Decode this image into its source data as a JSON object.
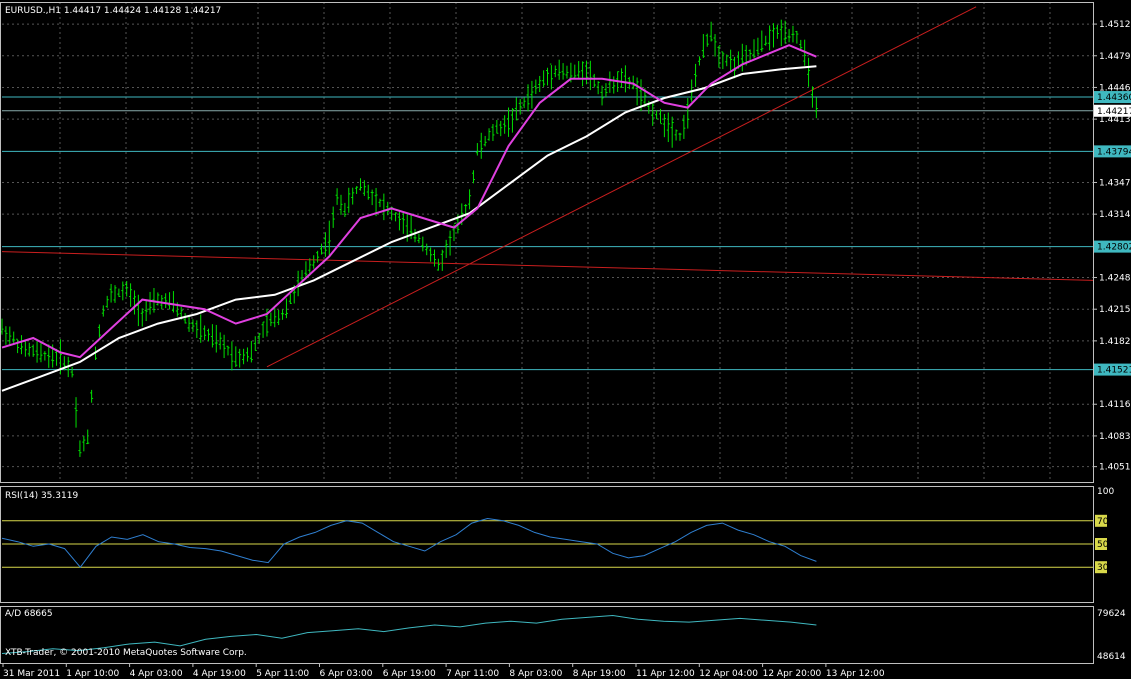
{
  "chart_data": {
    "type": "candlestick",
    "header": {
      "symbol": "EURUSD.,H1",
      "open": "1.44417",
      "high": "1.44424",
      "low": "1.44128",
      "close": "1.44217"
    },
    "price_ticks": [
      "1.45120",
      "1.44790",
      "1.44460",
      "1.44130",
      "1.43470",
      "1.43140",
      "1.42480",
      "1.42150",
      "1.41820",
      "1.41160",
      "1.40830",
      "1.40510"
    ],
    "price_ylim": [
      1.4035,
      1.4535
    ],
    "horizontal_levels": [
      {
        "value": "1.44360",
        "color": "#3fb8c0"
      },
      {
        "value": "1.43794",
        "color": "#3fb8c0"
      },
      {
        "value": "1.42802",
        "color": "#3fb8c0"
      },
      {
        "value": "1.41521",
        "color": "#3fb8c0"
      }
    ],
    "current_price": "1.44217",
    "time_labels": [
      "31 Mar 2011",
      "1 Apr 10:00",
      "4 Apr 03:00",
      "4 Apr 19:00",
      "5 Apr 11:00",
      "6 Apr 03:00",
      "6 Apr 19:00",
      "7 Apr 11:00",
      "8 Apr 03:00",
      "8 Apr 19:00",
      "11 Apr 12:00",
      "12 Apr 04:00",
      "12 Apr 20:00",
      "13 Apr 12:00"
    ],
    "price_path": [
      [
        0,
        1.4195
      ],
      [
        5,
        1.4175
      ],
      [
        10,
        1.4168
      ],
      [
        15,
        1.4165
      ],
      [
        18,
        1.415
      ],
      [
        20,
        1.407
      ],
      [
        22,
        1.408
      ],
      [
        24,
        1.417
      ],
      [
        26,
        1.4215
      ],
      [
        28,
        1.423
      ],
      [
        32,
        1.4235
      ],
      [
        36,
        1.421
      ],
      [
        40,
        1.4225
      ],
      [
        44,
        1.422
      ],
      [
        48,
        1.42
      ],
      [
        52,
        1.419
      ],
      [
        56,
        1.418
      ],
      [
        60,
        1.4165
      ],
      [
        64,
        1.417
      ],
      [
        68,
        1.42
      ],
      [
        72,
        1.421
      ],
      [
        76,
        1.424
      ],
      [
        80,
        1.4265
      ],
      [
        84,
        1.429
      ],
      [
        86,
        1.433
      ],
      [
        88,
        1.432
      ],
      [
        92,
        1.4345
      ],
      [
        96,
        1.433
      ],
      [
        100,
        1.4315
      ],
      [
        104,
        1.43
      ],
      [
        108,
        1.4285
      ],
      [
        112,
        1.426
      ],
      [
        116,
        1.4295
      ],
      [
        118,
        1.431
      ],
      [
        120,
        1.433
      ],
      [
        122,
        1.438
      ],
      [
        126,
        1.44
      ],
      [
        130,
        1.441
      ],
      [
        134,
        1.443
      ],
      [
        138,
        1.445
      ],
      [
        142,
        1.4465
      ],
      [
        146,
        1.446
      ],
      [
        150,
        1.4465
      ],
      [
        154,
        1.444
      ],
      [
        158,
        1.4455
      ],
      [
        162,
        1.445
      ],
      [
        166,
        1.4425
      ],
      [
        170,
        1.441
      ],
      [
        174,
        1.4395
      ],
      [
        176,
        1.442
      ],
      [
        178,
        1.446
      ],
      [
        180,
        1.4485
      ],
      [
        182,
        1.4505
      ],
      [
        184,
        1.448
      ],
      [
        188,
        1.447
      ],
      [
        192,
        1.448
      ],
      [
        196,
        1.4495
      ],
      [
        200,
        1.4505
      ],
      [
        204,
        1.45
      ],
      [
        206,
        1.448
      ],
      [
        208,
        1.444
      ],
      [
        209,
        1.4422
      ]
    ],
    "ma_slow_path": [
      [
        0,
        1.413
      ],
      [
        10,
        1.4145
      ],
      [
        20,
        1.416
      ],
      [
        30,
        1.4185
      ],
      [
        40,
        1.42
      ],
      [
        50,
        1.421
      ],
      [
        60,
        1.4225
      ],
      [
        70,
        1.423
      ],
      [
        80,
        1.4245
      ],
      [
        90,
        1.4265
      ],
      [
        100,
        1.4285
      ],
      [
        110,
        1.43
      ],
      [
        120,
        1.4315
      ],
      [
        130,
        1.4345
      ],
      [
        140,
        1.4375
      ],
      [
        150,
        1.4395
      ],
      [
        160,
        1.442
      ],
      [
        170,
        1.4435
      ],
      [
        180,
        1.4445
      ],
      [
        190,
        1.446
      ],
      [
        200,
        1.4465
      ],
      [
        209,
        1.4468
      ]
    ],
    "ma_fast_path": [
      [
        0,
        1.4175
      ],
      [
        8,
        1.4185
      ],
      [
        15,
        1.417
      ],
      [
        20,
        1.4165
      ],
      [
        28,
        1.4195
      ],
      [
        36,
        1.4225
      ],
      [
        44,
        1.422
      ],
      [
        52,
        1.4215
      ],
      [
        60,
        1.42
      ],
      [
        68,
        1.421
      ],
      [
        76,
        1.424
      ],
      [
        84,
        1.427
      ],
      [
        92,
        1.431
      ],
      [
        100,
        1.432
      ],
      [
        108,
        1.431
      ],
      [
        116,
        1.43
      ],
      [
        122,
        1.432
      ],
      [
        130,
        1.4385
      ],
      [
        138,
        1.443
      ],
      [
        146,
        1.4455
      ],
      [
        154,
        1.4455
      ],
      [
        162,
        1.445
      ],
      [
        170,
        1.443
      ],
      [
        176,
        1.4425
      ],
      [
        182,
        1.445
      ],
      [
        190,
        1.447
      ],
      [
        196,
        1.448
      ],
      [
        202,
        1.449
      ],
      [
        209,
        1.4478
      ]
    ],
    "trendline_up": [
      [
        68,
        1.4155
      ],
      [
        250,
        1.453
      ]
    ],
    "trendline_flat": [
      [
        0,
        1.4275
      ],
      [
        280,
        1.4245
      ]
    ],
    "rsi": {
      "label": "RSI(14) 35.3119",
      "ticks": [
        "100",
        "70",
        "50",
        "30"
      ],
      "levels": [
        70,
        50,
        30
      ],
      "values": [
        55,
        52,
        48,
        50,
        46,
        30,
        48,
        56,
        54,
        58,
        52,
        50,
        47,
        46,
        44,
        40,
        36,
        34,
        50,
        56,
        60,
        66,
        70,
        68,
        60,
        52,
        48,
        44,
        52,
        58,
        68,
        72,
        70,
        66,
        60,
        56,
        54,
        52,
        50,
        42,
        38,
        40,
        46,
        52,
        60,
        66,
        68,
        62,
        58,
        52,
        48,
        40,
        35
      ]
    },
    "ad": {
      "label": "A/D 68665",
      "ticks": [
        "79624",
        "48614"
      ],
      "values": [
        40,
        42,
        45,
        43,
        46,
        50,
        52,
        48,
        55,
        58,
        60,
        56,
        62,
        64,
        66,
        63,
        67,
        70,
        68,
        72,
        74,
        72,
        76,
        78,
        80,
        76,
        74,
        73,
        75,
        77,
        75,
        73,
        70
      ]
    },
    "copyright": "XTB-Trader, © 2001-2010 MetaQuotes Software Corp."
  }
}
